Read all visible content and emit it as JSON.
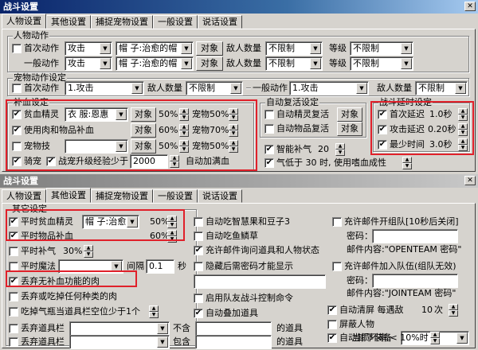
{
  "w1": {
    "title": "战斗设置",
    "tabs": [
      "人物设置",
      "其他设置",
      "捕捉宠物设置",
      "一般设置",
      "说话设置"
    ],
    "char_action": {
      "group": "人物动作",
      "first_label": "首次动作",
      "first_value": "攻击",
      "item_value": "帽    子:治愈的帽",
      "target_btn": "对象",
      "enemy_label": "敌人数量",
      "enemy_value": "不限制",
      "level_label": "等级",
      "level_value": "不限制",
      "normal_label": "一般动作",
      "normal_value": "攻击",
      "item2_value": "帽    子:治愈的帽",
      "target2_btn": "对象",
      "enemy2_label": "敌人数量",
      "enemy2_value": "不限制",
      "level2_label": "等级",
      "level2_value": "不限制"
    },
    "pet_action": {
      "group": "宠物动作设定",
      "first_label": "首次动作",
      "first_value": "1.攻击",
      "enemy_label": "敌人数量",
      "enemy_value": "不限制",
      "normal_label": "一般动作",
      "normal_value": "1.攻击",
      "enemy2_label": "敌人数量",
      "enemy2_value": "不限制"
    },
    "heal": {
      "group": "补血设定",
      "r1_label": "贫血精灵",
      "r1_value": "衣    服:恩惠",
      "r1_btn": "对象",
      "r1_pct": "50%",
      "r1_pet": "宠物50%",
      "r2_label": "使用肉和物品补血",
      "r2_btn": "对象",
      "r2_pct": "60%",
      "r2_pet": "宠物70%",
      "r3_label": "宠物技",
      "r3_btn": "对象",
      "r3_pct": "50%",
      "r3_pet": "宠物50%",
      "r4_label": "骑宠",
      "r4b_label": "战宠升级经验少于",
      "r4_value": "2000",
      "r4_full": "自动加满血"
    },
    "revive": {
      "group": "自动复活设定",
      "magic_label": "自动精灵复活",
      "magic_btn": "对象",
      "item_label": "自动物品复活",
      "item_btn": "对象",
      "mp_label": "智能补气",
      "mp_value": "20",
      "low_label": "气低于 30 时, 使用嗜血成性"
    },
    "delay": {
      "group": "战斗延时设定",
      "first_label": "首次延迟",
      "first_value": "1.0秒",
      "atk_label": "攻击延迟",
      "atk_value": "0.20秒",
      "min_label": "最少时间",
      "min_value": "3.0秒"
    }
  },
  "w2": {
    "title": "战斗设置",
    "tabs": [
      "人物设置",
      "其他设置",
      "捕捉宠物设置",
      "一般设置",
      "说话设置"
    ],
    "heal": {
      "group": "其它设定",
      "r1_label": "平时贫血精灵",
      "r1_value": "帽    子:治愈",
      "r1_pct": "50%",
      "r2_label": "平时物品补血",
      "r2_pct": "60%",
      "r3_label": "平时补气",
      "r3_pct": "30%",
      "r4_label": "平时魔法",
      "r4_interval": "间隔",
      "r4_value": "0.1",
      "r4_unit": "秒",
      "r5_label": "丢弃无补血功能的肉",
      "r6_label": "丢弃或吃掉任何种类的肉",
      "r7_label": "吃掉气瓶当道具栏空位少于1个",
      "r8_label": "丢弃道具栏",
      "r8_not": "不含",
      "r8_suffix": "的道具",
      "r9_label": "丢弃道具栏",
      "r9_contain": "包含",
      "r9_suffix": "的道具"
    },
    "mid": {
      "c1": "自动吃智慧果和豆子3",
      "c2": "自动吃鱼鳞草",
      "c3": "充许邮件询问道具和人物状态",
      "c4": "隐藏后需密码才能显示",
      "c5": "启用队友战斗控制命令",
      "c6": "自动叠加道具"
    },
    "right": {
      "c1": "充许邮件开组队[10秒后关闭]",
      "pwd_label": "密码：",
      "mail1": "邮件内容:\"OPENTEAM 密码\"",
      "c2": "充许邮件加入队伍(组队无效)",
      "pwd2_label": "密码：",
      "mail2": "邮件内容:\"JOINTEAM 密码\"",
      "c3": "自动清屏  每遇敌",
      "c3_value": "10",
      "c3_unit": "次",
      "c4": "屏蔽人物",
      "c5": "自动卸下装备",
      "wear_label": "当损坏率 < 10%时"
    }
  }
}
